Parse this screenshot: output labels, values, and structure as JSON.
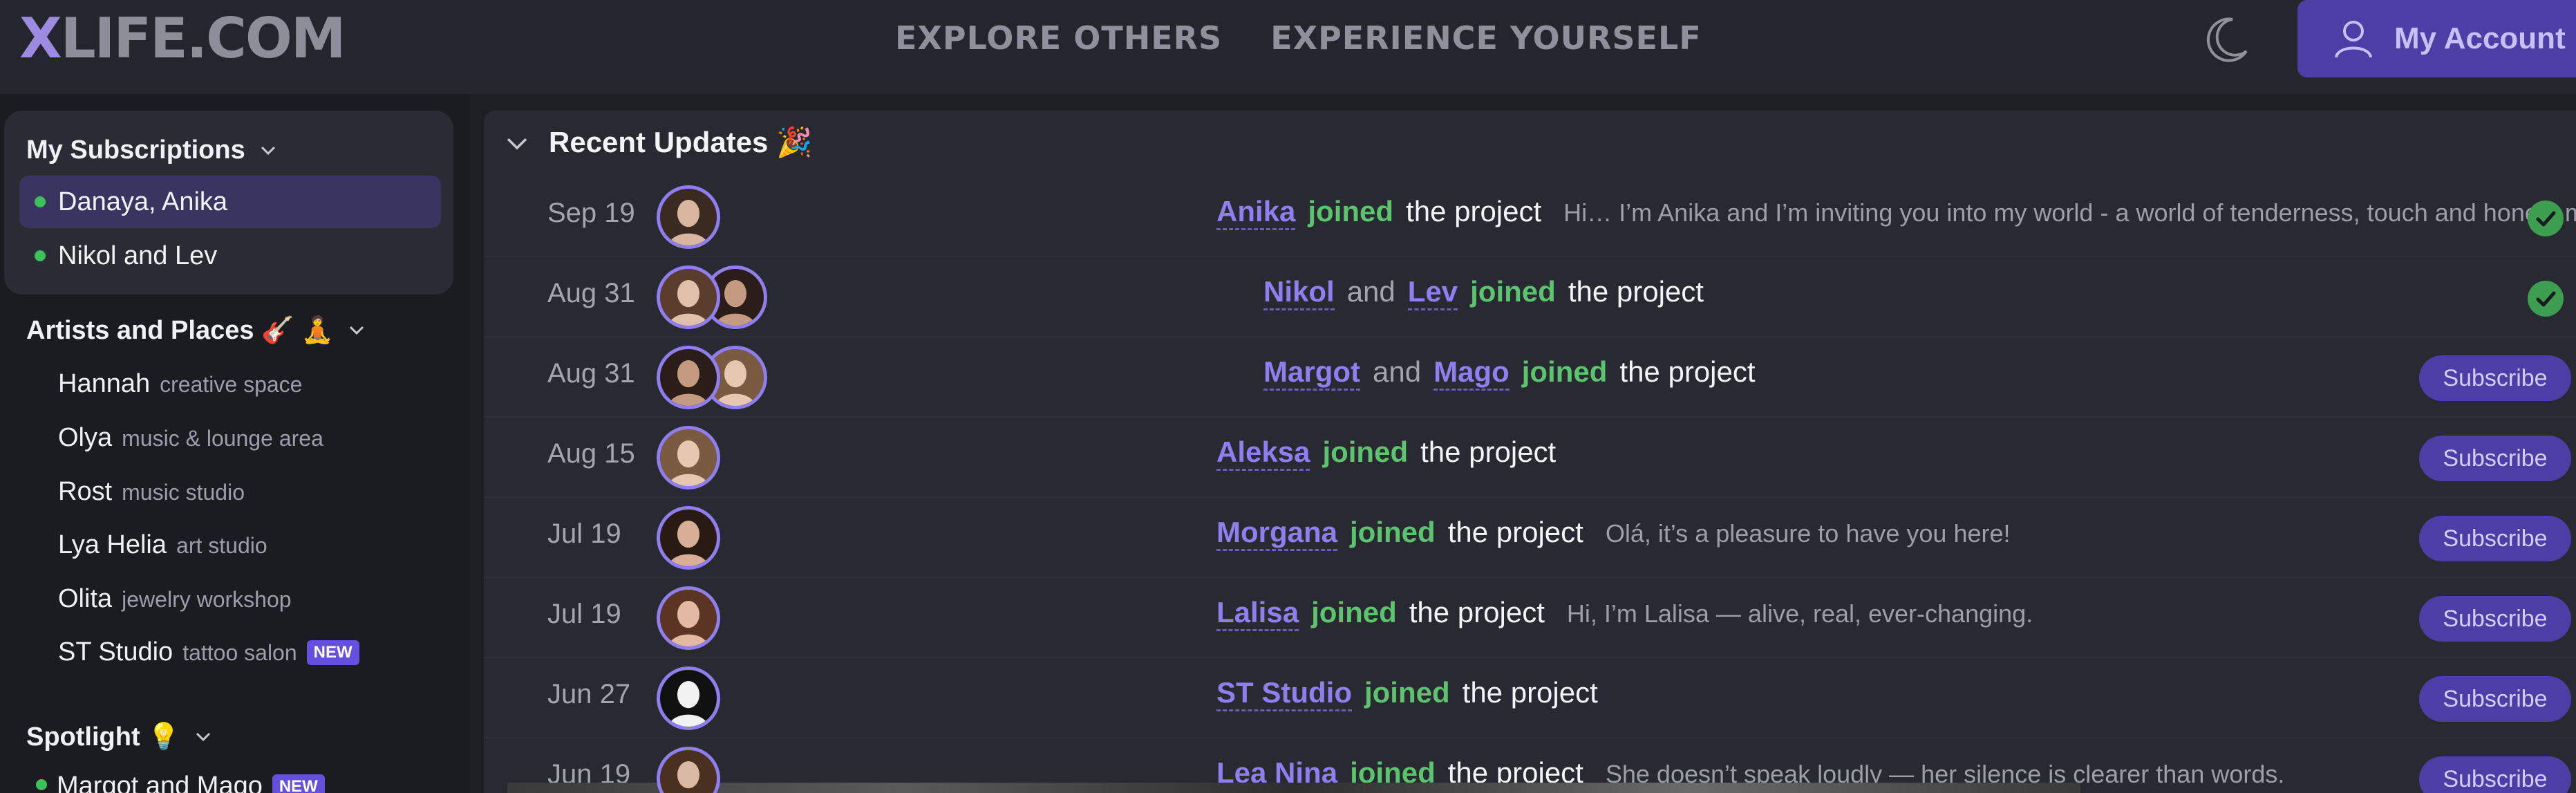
{
  "header": {
    "logo_x": "X",
    "logo_rest": "LIFE.COM",
    "nav": [
      "EXPLORE OTHERS",
      "EXPERIENCE YOURSELF"
    ],
    "account_label": "My Account"
  },
  "sidebar": {
    "subscriptions_title": "My Subscriptions",
    "subscriptions": [
      "Danaya, Anika",
      "Nikol and Lev"
    ],
    "artists_title": "Artists and Places 🎸 🧘",
    "places": [
      {
        "name": "Hannah",
        "desc": "creative space"
      },
      {
        "name": "Olya",
        "desc": "music & lounge area"
      },
      {
        "name": "Rost",
        "desc": "music studio"
      },
      {
        "name": "Lya Helia",
        "desc": "art studio"
      },
      {
        "name": "Olita",
        "desc": "jewelry workshop"
      },
      {
        "name": "ST Studio",
        "desc": "tattoo salon",
        "badge": "NEW"
      }
    ],
    "spotlight_title": "Spotlight 💡",
    "spotlight_items": [
      {
        "name": "Margot and Mago",
        "badge": "NEW"
      }
    ]
  },
  "updates": {
    "title": "Recent Updates 🎉",
    "and_word": "and",
    "joined_word": "joined",
    "project_word": "the project",
    "subscribe_label": "Subscribe",
    "rows": [
      {
        "date": "Sep 19",
        "names": [
          "Anika"
        ],
        "message": "Hi… I’m Anika and I’m inviting you into my world - a world of tenderness, touch and honest moments.",
        "status": "subscribed"
      },
      {
        "date": "Aug 31",
        "names": [
          "Nikol",
          "Lev"
        ],
        "message": "",
        "status": "subscribed"
      },
      {
        "date": "Aug 31",
        "names": [
          "Margot",
          "Mago"
        ],
        "message": "",
        "status": "subscribe"
      },
      {
        "date": "Aug 15",
        "names": [
          "Aleksa"
        ],
        "message": "",
        "status": "subscribe"
      },
      {
        "date": "Jul 19",
        "names": [
          "Morgana"
        ],
        "message": "Olá, it’s a pleasure to have you here!",
        "status": "subscribe"
      },
      {
        "date": "Jul 19",
        "names": [
          "Lalisa"
        ],
        "message": "Hi, I’m Lalisa — alive, real, ever-changing.",
        "status": "subscribe"
      },
      {
        "date": "Jun 27",
        "names": [
          "ST Studio"
        ],
        "message": "",
        "status": "subscribe"
      },
      {
        "date": "Jun 19",
        "names": [
          "Lea Nina"
        ],
        "message": "She doesn’t speak loudly — her silence is clearer than words.",
        "status": "subscribe"
      }
    ]
  },
  "colors": {
    "accent": "#8f7ef0",
    "button": "#4d3ea6",
    "joined": "#5cc46e",
    "background": "#1e1f25"
  }
}
